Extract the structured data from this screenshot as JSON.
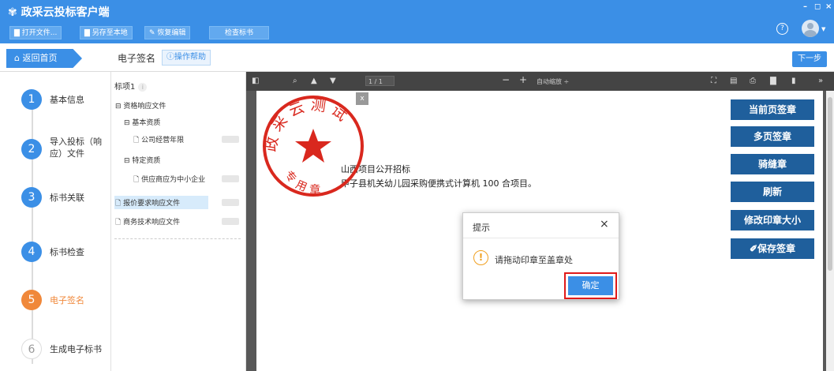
{
  "app": {
    "title": "政采云投标客户端",
    "title_icon": "flower-logo-icon",
    "win_min": "–",
    "win_max": "◻",
    "win_close": "×"
  },
  "toolbar": {
    "open_file": "打开文件...",
    "save_local": "另存至本地",
    "restore_edit": "恢复编辑",
    "check_bid": "检查标书"
  },
  "header": {
    "help_symbol": "?"
  },
  "nav": {
    "home": "返回首页",
    "page_title": "电子签名",
    "help": "操作帮助",
    "next": "下一步"
  },
  "steps": [
    {
      "num": "1",
      "label": "基本信息"
    },
    {
      "num": "2",
      "label": "导入投标（响应）文件"
    },
    {
      "num": "3",
      "label": "标书关联"
    },
    {
      "num": "4",
      "label": "标书检查"
    },
    {
      "num": "5",
      "label": "电子签名"
    },
    {
      "num": "6",
      "label": "生成电子标书"
    }
  ],
  "tree": {
    "header": "标项1",
    "info": "i",
    "items": [
      {
        "label": "资格响应文件",
        "sign": "⊟"
      },
      {
        "label": "基本资质",
        "sign": "⊟"
      },
      {
        "label": "公司经营年限",
        "sign": "🗋"
      },
      {
        "label": "特定资质",
        "sign": "⊟"
      },
      {
        "label": "供应商应为中小企业",
        "sign": "🗋"
      },
      {
        "label": "报价要求响应文件",
        "sign": "🗋"
      },
      {
        "label": "商务技术响应文件",
        "sign": "🗋"
      }
    ]
  },
  "pdf": {
    "page": "1",
    "total": "/ 1",
    "zoom": "自动缩放 ÷",
    "zoom_out": "−",
    "zoom_in": "+"
  },
  "document": {
    "line1": "山西项目公开招标",
    "line2": "甲子县机关幼儿园采购便携式计算机 100 合项目。"
  },
  "seal": {
    "top_text": "政采云测试",
    "bottom_text": "专用章",
    "close": "x"
  },
  "sign_buttons": [
    "当前页签章",
    "多页签章",
    "骑缝章",
    "刷新",
    "修改印章大小",
    "✐保存签章"
  ],
  "dialog": {
    "title": "提示",
    "close": "×",
    "icon": "!",
    "message": "请拖动印章至盖章处",
    "ok": "确定"
  },
  "colors": {
    "accent": "#3b8fe6",
    "active_step": "#f0883a",
    "seal": "#d9281e",
    "sign_btn": "#1f5f9c",
    "highlight": "#e01a1a"
  }
}
